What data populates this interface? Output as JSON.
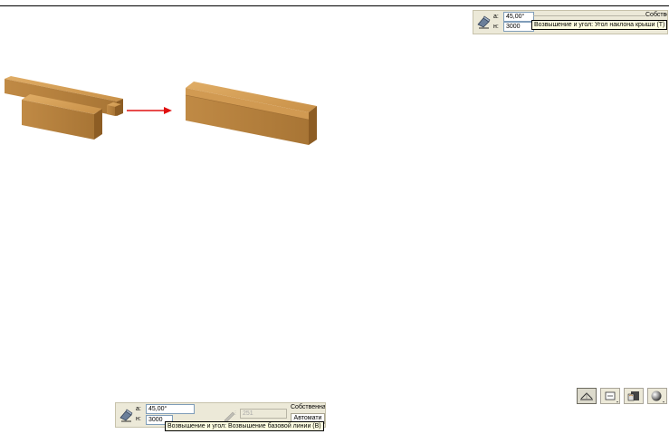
{
  "top_toolbar": {
    "label_a": "a:",
    "label_h": "н:",
    "angle_value": "45,00°",
    "height_value": "3000",
    "tab_label": "Собстве",
    "tooltip": "Возвышение и угол: Угол наклона крыши (T)"
  },
  "bottom_toolbar": {
    "label_a": "a:",
    "label_h": "н:",
    "angle_value": "45,00°",
    "height_value": "3000",
    "disabled_value": "251",
    "tab_label": "Собственна",
    "mode_value": "Автомати",
    "tooltip": "Возвышение и угол: Возвышение базовой линии (B)"
  },
  "icon_row": {
    "icons": [
      "roof-shape-icon",
      "section-icon",
      "building-material-icon",
      "sphere-render-icon"
    ]
  },
  "colors": {
    "wood_top": "#d8a35a",
    "wood_front": "#b7813d",
    "wood_side": "#8d5d24",
    "arrow": "#e01010",
    "panel_bg": "#ece9d8",
    "tooltip_bg": "#ffffe1"
  }
}
